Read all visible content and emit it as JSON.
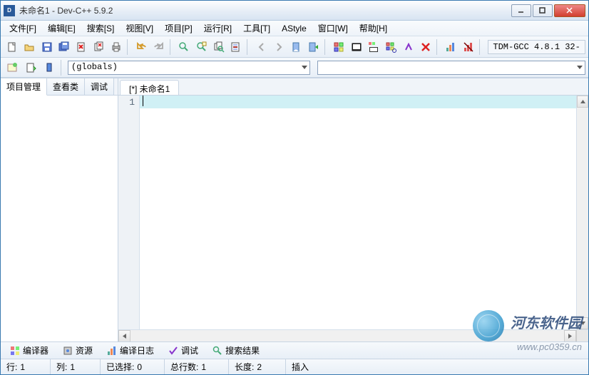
{
  "title": "未命名1 - Dev-C++ 5.9.2",
  "menu": {
    "file": "文件[F]",
    "edit": "编辑[E]",
    "search": "搜索[S]",
    "view": "视图[V]",
    "project": "项目[P]",
    "run": "运行[R]",
    "tools": "工具[T]",
    "astyle": "AStyle",
    "window": "窗口[W]",
    "help": "帮助[H]"
  },
  "compiler_label": "TDM-GCC 4.8.1 32-",
  "scope_combo": "(globals)",
  "left_tabs": {
    "project": "项目管理",
    "classes": "查看类",
    "debug": "调试"
  },
  "file_tab": "[*] 未命名1",
  "gutter_line": "1",
  "bottom_tabs": {
    "compiler": "编译器",
    "resources": "资源",
    "compilelog": "编译日志",
    "debug": "调试",
    "findresults": "搜索结果"
  },
  "status": {
    "line_label": "行:",
    "line_val": "1",
    "col_label": "列:",
    "col_val": "1",
    "sel_label": "已选择:",
    "sel_val": "0",
    "total_label": "总行数:",
    "total_val": "1",
    "len_label": "长度:",
    "len_val": "2",
    "insert": "插入"
  },
  "watermark": {
    "name": "河东软件园",
    "url": "www.pc0359.cn"
  }
}
